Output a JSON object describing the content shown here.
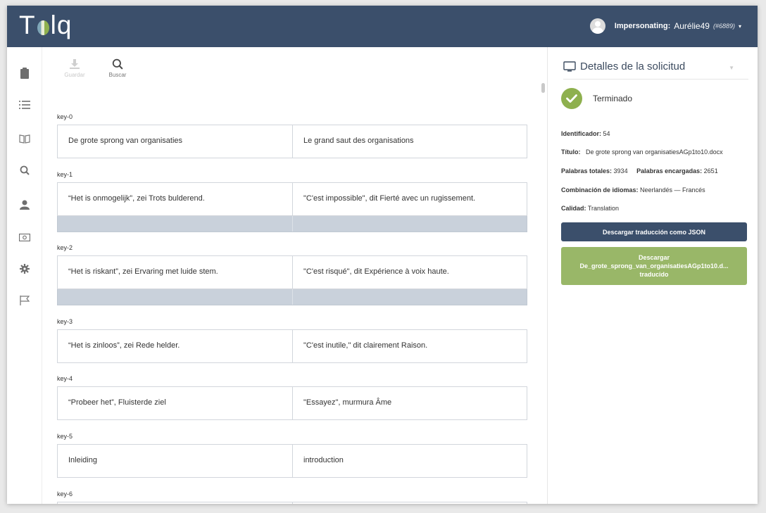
{
  "header": {
    "logo_left": "T",
    "logo_right": "lq",
    "impersonating_label": "Impersonating:",
    "user_name": "Aurélie49",
    "user_id": "(#6889)",
    "caret": "▾"
  },
  "toolbar": {
    "save_label": "Guardar",
    "search_label": "Buscar"
  },
  "segments": [
    {
      "key": "key-0",
      "source": "De grote sprong van organisaties",
      "target": "Le grand saut des organisations"
    },
    {
      "key": "key-1",
      "source": "“Het is onmogelijk”, zei Trots bulderend.",
      "target": "\"C'est impossible\", dit Fierté avec un rugissement."
    },
    {
      "key": "key-2",
      "source": "“Het is riskant”, zei Ervaring met luide stem.",
      "target": "\"C'est risqué\", dit Expérience à voix haute."
    },
    {
      "key": "key-3",
      "source": "“Het is zinloos”, zei Rede helder.",
      "target": "\"C'est inutile,\" dit clairement Raison."
    },
    {
      "key": "key-4",
      "source": "“Probeer het”, Fluisterde ziel",
      "target": "\"Essayez\", murmura Âme"
    },
    {
      "key": "key-5",
      "source": "Inleiding",
      "target": "introduction"
    },
    {
      "key": "key-6",
      "source": "",
      "target": ""
    }
  ],
  "panel": {
    "title": "Detalles de la solicitud",
    "status": "Terminado",
    "identifier_label": "Identificador:",
    "identifier_value": "54",
    "title_label": "Título:",
    "title_value": "De grote sprong van organisatiesAGp1to10.docx",
    "total_words_label": "Palabras totales:",
    "total_words_value": "3934",
    "ordered_words_label": "Palabras encargadas:",
    "ordered_words_value": "2651",
    "language_pair_label": "Combinación de idiomas:",
    "language_pair_value": "Neerlandés — Francés",
    "quality_label": "Calidad:",
    "quality_value": "Translation",
    "download_json_label": "Descargar traducción como JSON",
    "download_file_line1": "Descargar",
    "download_file_line2": "De_grote_sprong_van_organisatiesAGp1to10.d...",
    "download_file_line3": "traducido"
  },
  "colors": {
    "header": "#3b4f6b",
    "success": "#8eb04e",
    "download_green": "#99b768",
    "highlight_row": "#c9d1db"
  },
  "sidebar_icons": [
    "clipboard-icon",
    "list-icon",
    "book-icon",
    "search-icon",
    "user-icon",
    "money-icon",
    "gear-icon",
    "flag-icon"
  ]
}
